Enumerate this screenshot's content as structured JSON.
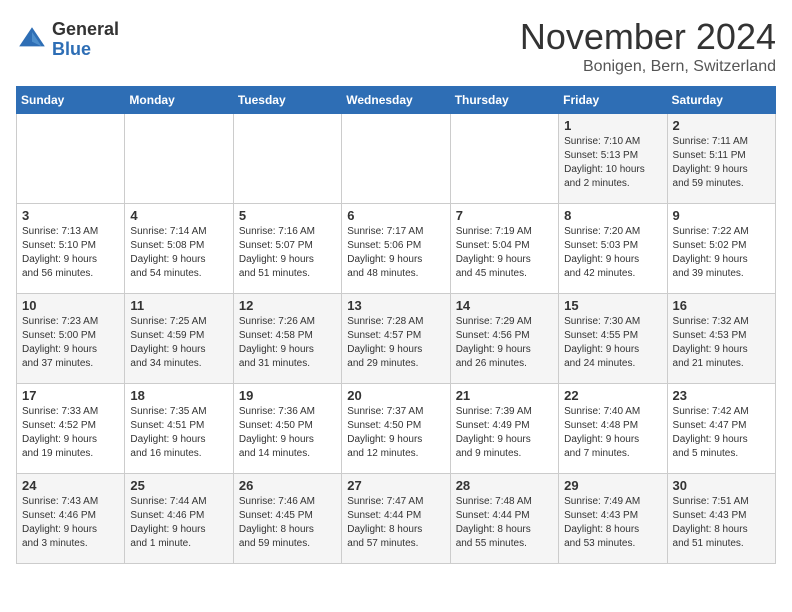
{
  "logo": {
    "general": "General",
    "blue": "Blue"
  },
  "title": "November 2024",
  "location": "Bonigen, Bern, Switzerland",
  "weekdays": [
    "Sunday",
    "Monday",
    "Tuesday",
    "Wednesday",
    "Thursday",
    "Friday",
    "Saturday"
  ],
  "weeks": [
    [
      {
        "day": "",
        "info": ""
      },
      {
        "day": "",
        "info": ""
      },
      {
        "day": "",
        "info": ""
      },
      {
        "day": "",
        "info": ""
      },
      {
        "day": "",
        "info": ""
      },
      {
        "day": "1",
        "info": "Sunrise: 7:10 AM\nSunset: 5:13 PM\nDaylight: 10 hours\nand 2 minutes."
      },
      {
        "day": "2",
        "info": "Sunrise: 7:11 AM\nSunset: 5:11 PM\nDaylight: 9 hours\nand 59 minutes."
      }
    ],
    [
      {
        "day": "3",
        "info": "Sunrise: 7:13 AM\nSunset: 5:10 PM\nDaylight: 9 hours\nand 56 minutes."
      },
      {
        "day": "4",
        "info": "Sunrise: 7:14 AM\nSunset: 5:08 PM\nDaylight: 9 hours\nand 54 minutes."
      },
      {
        "day": "5",
        "info": "Sunrise: 7:16 AM\nSunset: 5:07 PM\nDaylight: 9 hours\nand 51 minutes."
      },
      {
        "day": "6",
        "info": "Sunrise: 7:17 AM\nSunset: 5:06 PM\nDaylight: 9 hours\nand 48 minutes."
      },
      {
        "day": "7",
        "info": "Sunrise: 7:19 AM\nSunset: 5:04 PM\nDaylight: 9 hours\nand 45 minutes."
      },
      {
        "day": "8",
        "info": "Sunrise: 7:20 AM\nSunset: 5:03 PM\nDaylight: 9 hours\nand 42 minutes."
      },
      {
        "day": "9",
        "info": "Sunrise: 7:22 AM\nSunset: 5:02 PM\nDaylight: 9 hours\nand 39 minutes."
      }
    ],
    [
      {
        "day": "10",
        "info": "Sunrise: 7:23 AM\nSunset: 5:00 PM\nDaylight: 9 hours\nand 37 minutes."
      },
      {
        "day": "11",
        "info": "Sunrise: 7:25 AM\nSunset: 4:59 PM\nDaylight: 9 hours\nand 34 minutes."
      },
      {
        "day": "12",
        "info": "Sunrise: 7:26 AM\nSunset: 4:58 PM\nDaylight: 9 hours\nand 31 minutes."
      },
      {
        "day": "13",
        "info": "Sunrise: 7:28 AM\nSunset: 4:57 PM\nDaylight: 9 hours\nand 29 minutes."
      },
      {
        "day": "14",
        "info": "Sunrise: 7:29 AM\nSunset: 4:56 PM\nDaylight: 9 hours\nand 26 minutes."
      },
      {
        "day": "15",
        "info": "Sunrise: 7:30 AM\nSunset: 4:55 PM\nDaylight: 9 hours\nand 24 minutes."
      },
      {
        "day": "16",
        "info": "Sunrise: 7:32 AM\nSunset: 4:53 PM\nDaylight: 9 hours\nand 21 minutes."
      }
    ],
    [
      {
        "day": "17",
        "info": "Sunrise: 7:33 AM\nSunset: 4:52 PM\nDaylight: 9 hours\nand 19 minutes."
      },
      {
        "day": "18",
        "info": "Sunrise: 7:35 AM\nSunset: 4:51 PM\nDaylight: 9 hours\nand 16 minutes."
      },
      {
        "day": "19",
        "info": "Sunrise: 7:36 AM\nSunset: 4:50 PM\nDaylight: 9 hours\nand 14 minutes."
      },
      {
        "day": "20",
        "info": "Sunrise: 7:37 AM\nSunset: 4:50 PM\nDaylight: 9 hours\nand 12 minutes."
      },
      {
        "day": "21",
        "info": "Sunrise: 7:39 AM\nSunset: 4:49 PM\nDaylight: 9 hours\nand 9 minutes."
      },
      {
        "day": "22",
        "info": "Sunrise: 7:40 AM\nSunset: 4:48 PM\nDaylight: 9 hours\nand 7 minutes."
      },
      {
        "day": "23",
        "info": "Sunrise: 7:42 AM\nSunset: 4:47 PM\nDaylight: 9 hours\nand 5 minutes."
      }
    ],
    [
      {
        "day": "24",
        "info": "Sunrise: 7:43 AM\nSunset: 4:46 PM\nDaylight: 9 hours\nand 3 minutes."
      },
      {
        "day": "25",
        "info": "Sunrise: 7:44 AM\nSunset: 4:46 PM\nDaylight: 9 hours\nand 1 minute."
      },
      {
        "day": "26",
        "info": "Sunrise: 7:46 AM\nSunset: 4:45 PM\nDaylight: 8 hours\nand 59 minutes."
      },
      {
        "day": "27",
        "info": "Sunrise: 7:47 AM\nSunset: 4:44 PM\nDaylight: 8 hours\nand 57 minutes."
      },
      {
        "day": "28",
        "info": "Sunrise: 7:48 AM\nSunset: 4:44 PM\nDaylight: 8 hours\nand 55 minutes."
      },
      {
        "day": "29",
        "info": "Sunrise: 7:49 AM\nSunset: 4:43 PM\nDaylight: 8 hours\nand 53 minutes."
      },
      {
        "day": "30",
        "info": "Sunrise: 7:51 AM\nSunset: 4:43 PM\nDaylight: 8 hours\nand 51 minutes."
      }
    ]
  ]
}
